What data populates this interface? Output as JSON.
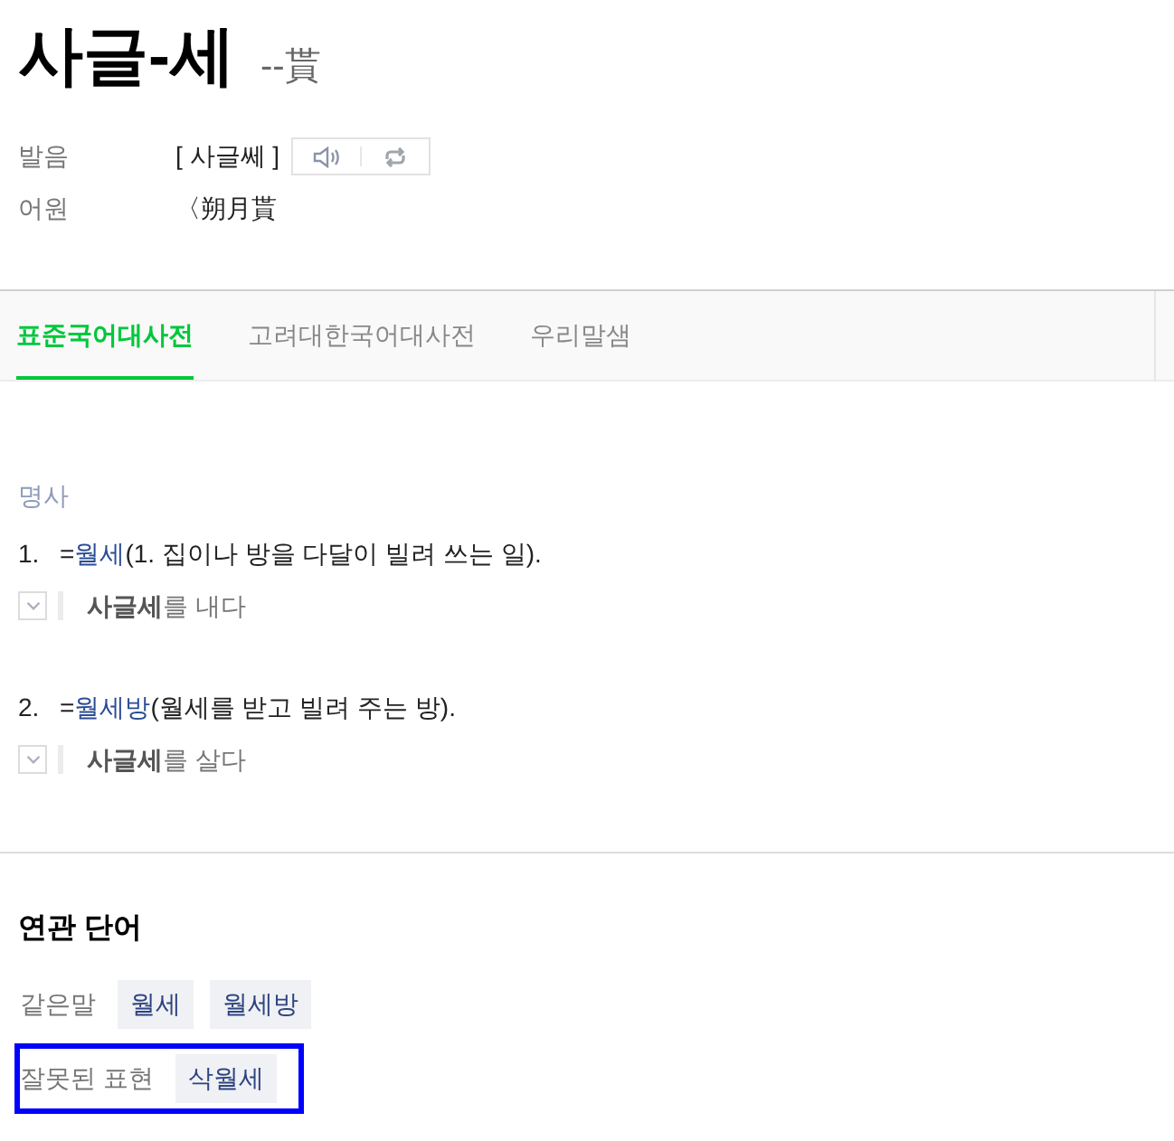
{
  "entry": {
    "headword": "사글-세",
    "hanja": "--貰"
  },
  "info": [
    {
      "kind": "pronunciation",
      "label": "발음",
      "value": "[ 사글쎄 ]"
    },
    {
      "kind": "etymology",
      "label": "어원",
      "value": "〈朔月貰"
    }
  ],
  "tabs": [
    {
      "label": "표준국어대사전",
      "selected": true
    },
    {
      "label": "고려대한국어대사전",
      "selected": false
    },
    {
      "label": "우리말샘",
      "selected": false
    }
  ],
  "part_of_speech": "명사",
  "senses": [
    {
      "number": "1.",
      "prefix": "=",
      "link": "월세",
      "gloss": "(1. 집이나 방을 다달이 빌려 쓰는 일).",
      "example": "**사글세**를 내다",
      "expanded": false
    },
    {
      "number": "2.",
      "prefix": "=",
      "link": "월세방",
      "gloss": "(월세를 받고 빌려 주는 방).",
      "example": "**사글세**를 살다",
      "expanded": false
    }
  ],
  "related": {
    "title": "연관 단어",
    "groups": [
      {
        "label": "같은말",
        "words": [
          "월세",
          "월세방"
        ],
        "highlighted": false
      },
      {
        "label": "잘못된 표현",
        "words": [
          "삭월세"
        ],
        "highlighted": true
      }
    ]
  }
}
